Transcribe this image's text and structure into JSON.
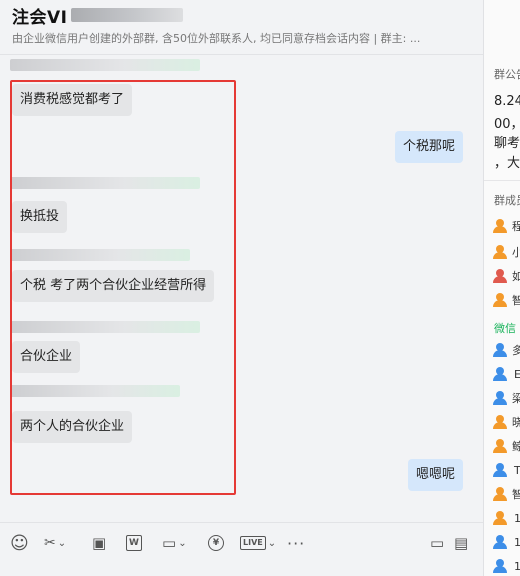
{
  "header": {
    "title": "注会VI",
    "subtitle": "由企业微信用户创建的外部群, 含50位外部联系人, 均已同意存档会话内容  | 群主: ..."
  },
  "messages": [
    {
      "text": "消费税感觉都考了"
    },
    {
      "text": "个税那呢"
    },
    {
      "text": "换抵投"
    },
    {
      "text": "个税  考了两个合伙企业经营所得"
    },
    {
      "text": "合伙企业"
    },
    {
      "text": "两个人的合伙企业"
    },
    {
      "text": "嗯嗯呢"
    }
  ],
  "toolbar": {
    "emoji": "☺",
    "scissors": "✂",
    "scissors_caret": "⌄",
    "image": "▣",
    "word": "W",
    "folder": "▭",
    "folder_caret": "⌄",
    "money": "¥",
    "live": "LIVE",
    "more": "···",
    "history": "▭",
    "sidebar": "▤"
  },
  "side": {
    "notice_title": "群公告",
    "notice_lines": [
      "8.24",
      "00，",
      "聊考",
      "，大"
    ],
    "members_title": "群成员",
    "wx_label": "微信",
    "members": [
      {
        "name": "程",
        "color": "#f39a2b"
      },
      {
        "name": "小",
        "color": "#f39a2b"
      },
      {
        "name": "如",
        "color": "#e05a4e"
      },
      {
        "name": "智",
        "color": "#f39a2b"
      },
      {
        "name": "多",
        "color": "#3d8ee8"
      },
      {
        "name": "E",
        "color": "#3d8ee8"
      },
      {
        "name": "梁",
        "color": "#3d8ee8"
      },
      {
        "name": "晓",
        "color": "#f39a2b"
      },
      {
        "name": "鲸",
        "color": "#f39a2b"
      },
      {
        "name": "T",
        "color": "#3d8ee8"
      },
      {
        "name": "智",
        "color": "#f39a2b"
      },
      {
        "name": "1",
        "color": "#f39a2b"
      },
      {
        "name": "1",
        "color": "#3d8ee8"
      },
      {
        "name": "1",
        "color": "#3d8ee8"
      }
    ]
  }
}
